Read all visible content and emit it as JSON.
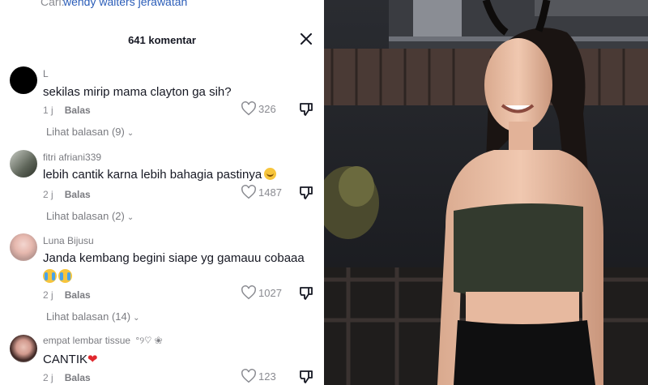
{
  "search": {
    "prefix": "Cari:",
    "query": "wendy walters jerawatan"
  },
  "header": {
    "count_label": "641 komentar"
  },
  "comments": [
    {
      "username": "L",
      "text": "sekilas mirip mama clayton ga sih?",
      "time": "1 j",
      "reply_label": "Balas",
      "likes": "326",
      "view_replies": "Lihat balasan (9)"
    },
    {
      "username": "fitri afriani339",
      "text": "lebih cantik karna lebih bahagia pastinya",
      "emoji": "smiling-face",
      "time": "2 j",
      "reply_label": "Balas",
      "likes": "1487",
      "view_replies": "Lihat balasan (2)"
    },
    {
      "username": "Luna Bijusu",
      "text": "Janda kembang begini siape yg gamauu cobaaa",
      "emoji": "crying-face x2",
      "time": "2 j",
      "reply_label": "Balas",
      "likes": "1027",
      "view_replies": "Lihat balasan (14)"
    },
    {
      "username": "empat lembar tissue",
      "username_decor": "°୨♡ ❀",
      "text": "CANTIK",
      "emoji": "red-heart",
      "time": "2 j",
      "reply_label": "Balas",
      "likes": "123"
    }
  ],
  "colors": {
    "link": "#2b5db8",
    "muted": "#8a8b91",
    "heart": "#e0282e"
  }
}
